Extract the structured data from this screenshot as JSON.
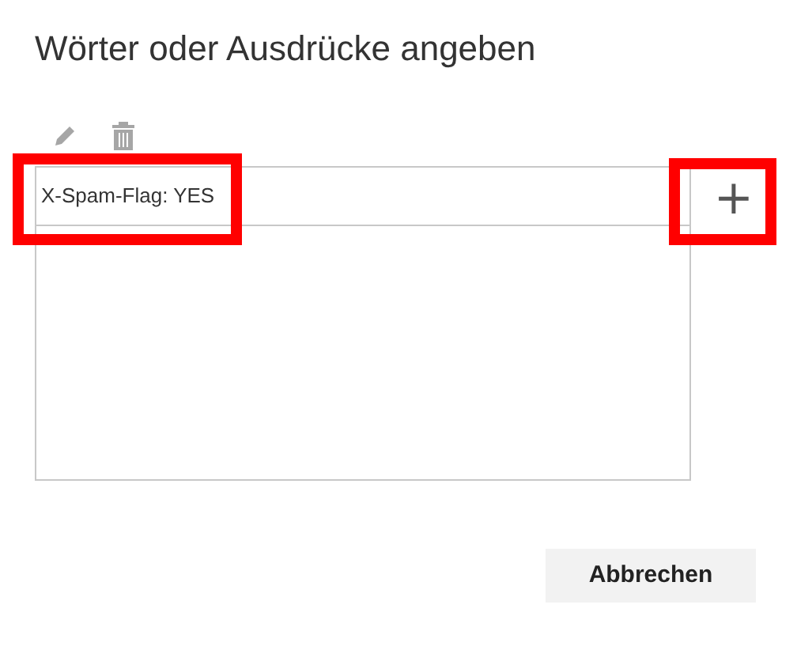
{
  "title": "Wörter oder Ausdrücke angeben",
  "entry": {
    "value": "X-Spam-Flag: YES",
    "highlighted": true
  },
  "add_button": {
    "label": "+",
    "highlighted": true
  },
  "buttons": [
    "Abbrechen"
  ]
}
